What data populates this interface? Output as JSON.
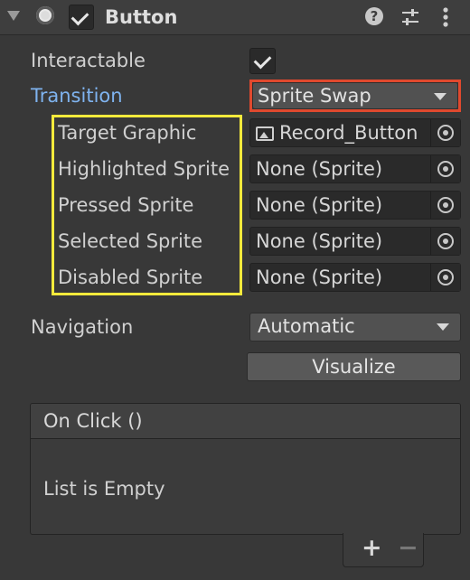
{
  "header": {
    "title": "Button",
    "help_glyph": "?",
    "enabled": true,
    "icons": [
      "fold-arrow-icon",
      "button-component-icon",
      "help-icon",
      "preset-icon",
      "context-menu-icon"
    ]
  },
  "fields": {
    "interactable": {
      "label": "Interactable",
      "checked": true
    },
    "transition": {
      "label": "Transition",
      "value": "Sprite Swap"
    },
    "target_graphic": {
      "label": "Target Graphic",
      "value": "Record_Button"
    },
    "highlighted_sprite": {
      "label": "Highlighted Sprite",
      "value": "None (Sprite)"
    },
    "pressed_sprite": {
      "label": "Pressed Sprite",
      "value": "None (Sprite)"
    },
    "selected_sprite": {
      "label": "Selected Sprite",
      "value": "None (Sprite)"
    },
    "disabled_sprite": {
      "label": "Disabled Sprite",
      "value": "None (Sprite)"
    },
    "navigation": {
      "label": "Navigation",
      "value": "Automatic"
    }
  },
  "visualize_label": "Visualize",
  "on_click": {
    "header": "On Click ()",
    "empty_text": "List is Empty",
    "add_glyph": "+",
    "remove_glyph": "−"
  },
  "highlight_colors": {
    "red_box": "#e0492e",
    "yellow_box": "#f4ea3c",
    "transition_label": "#7fb3ef"
  }
}
